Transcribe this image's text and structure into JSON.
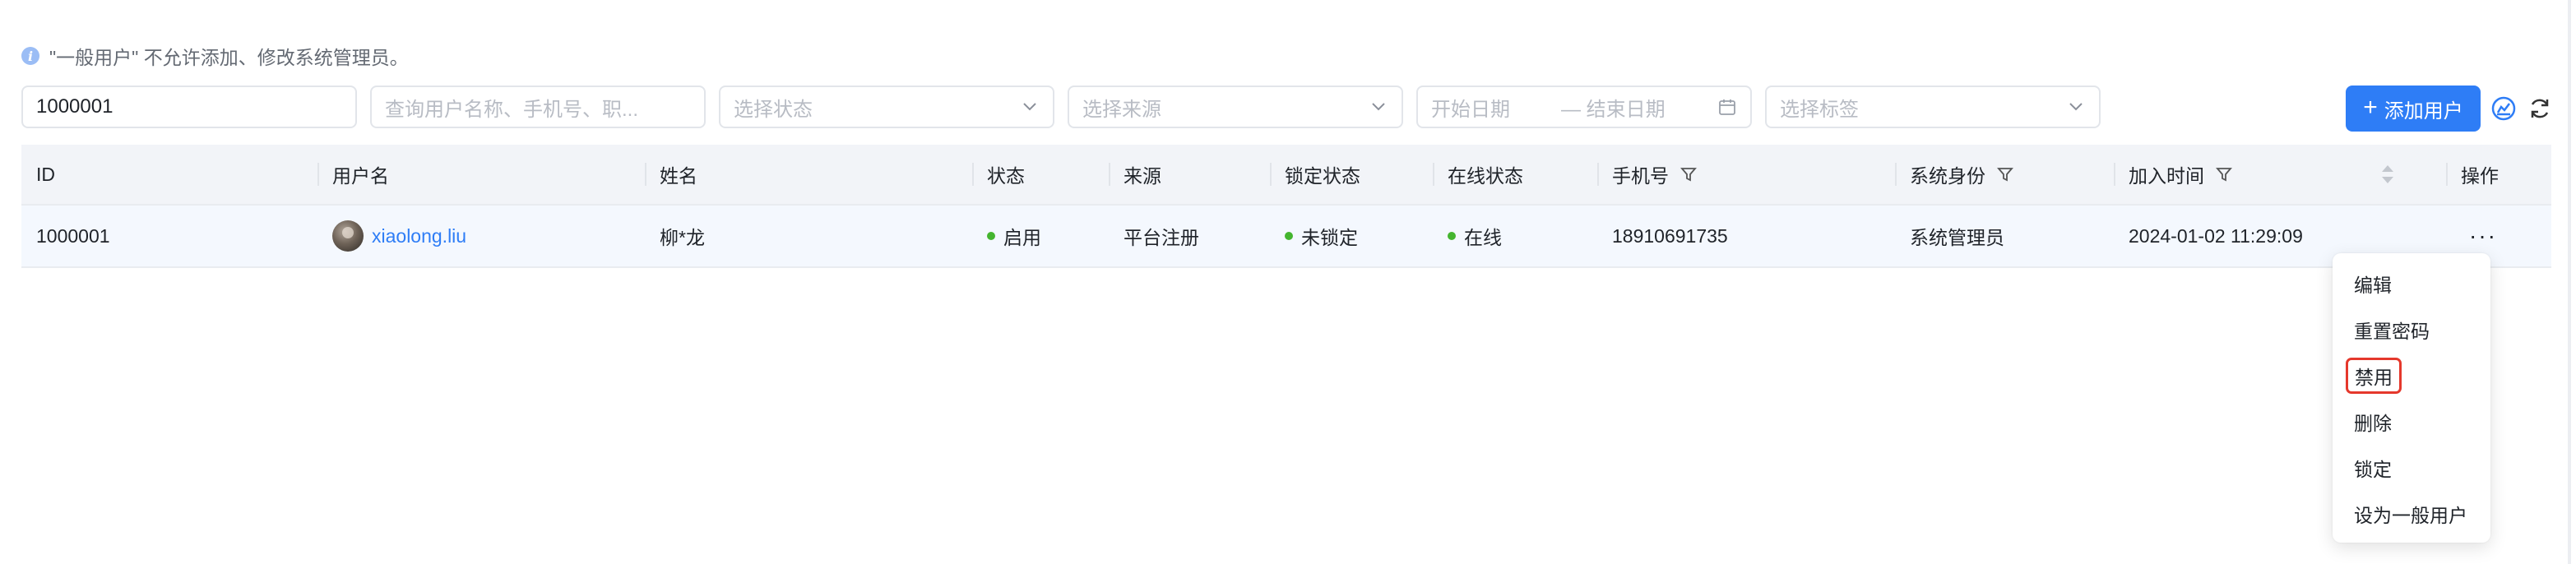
{
  "notice": {
    "text": "\"一般用户\" 不允许添加、修改系统管理员。"
  },
  "filters": {
    "id_value": "1000001",
    "search_placeholder": "查询用户名称、手机号、职...",
    "status_placeholder": "选择状态",
    "source_placeholder": "选择来源",
    "start_date_placeholder": "开始日期",
    "end_date_placeholder": "— 结束日期",
    "tag_placeholder": "选择标签"
  },
  "toolbar": {
    "add_user_label": "添加用户",
    "plus": "+"
  },
  "table": {
    "headers": {
      "id": "ID",
      "username": "用户名",
      "name": "姓名",
      "status": "状态",
      "source": "来源",
      "lock": "锁定状态",
      "online": "在线状态",
      "phone": "手机号",
      "role": "系统身份",
      "joined": "加入时间",
      "actions": "操作"
    },
    "rows": [
      {
        "id": "1000001",
        "username": "xiaolong.liu",
        "name": "柳*龙",
        "status": "启用",
        "source": "平台注册",
        "lock": "未锁定",
        "online": "在线",
        "phone": "18910691735",
        "role": "系统管理员",
        "joined": "2024-01-02 11:29:09",
        "actions": "···"
      }
    ]
  },
  "menu": {
    "items": [
      "编辑",
      "重置密码",
      "禁用",
      "删除",
      "锁定",
      "设为一般用户"
    ],
    "highlighted": "禁用"
  },
  "colors": {
    "accent": "#2e7df6",
    "status_green": "#44b52f",
    "highlight_border": "#e5382c"
  },
  "icons": [
    "info-icon",
    "plus-icon",
    "chevron-down-icon",
    "calendar-icon",
    "filter-icon",
    "sort-icon",
    "column-settings-icon",
    "refresh-icon",
    "more-icon"
  ]
}
